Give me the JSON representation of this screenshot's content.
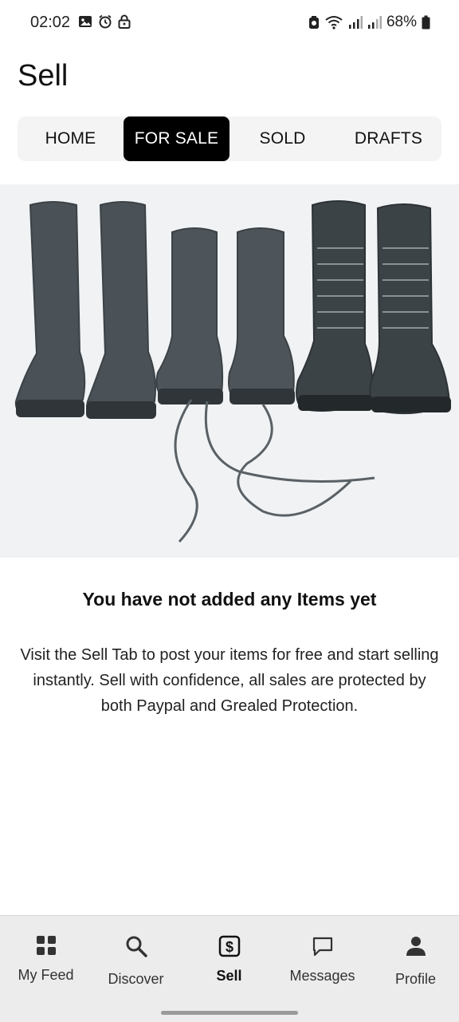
{
  "status_bar": {
    "time": "02:02",
    "battery": "68%",
    "icons": [
      "gallery-icon",
      "alarm-icon",
      "lock-icon",
      "data-saver-icon",
      "wifi-icon",
      "signal-icon",
      "signal-icon",
      "battery-icon"
    ]
  },
  "header": {
    "title": "Sell"
  },
  "tabs": [
    {
      "label": "HOME",
      "active": false
    },
    {
      "label": "FOR SALE",
      "active": true
    },
    {
      "label": "SOLD",
      "active": false
    },
    {
      "label": "DRAFTS",
      "active": false
    }
  ],
  "hero": {
    "image": "boots-photo"
  },
  "empty_state": {
    "heading": "You have not added any Items yet",
    "body": "Visit the Sell Tab to post your items for free and start selling instantly. Sell with confidence, all sales are protected by both Paypal and Grealed Protection."
  },
  "bottom_nav": [
    {
      "label": "My Feed",
      "icon": "grid-icon",
      "active": false
    },
    {
      "label": "Discover",
      "icon": "search-icon",
      "active": false
    },
    {
      "label": "Sell",
      "icon": "dollar-tag-icon",
      "active": true
    },
    {
      "label": "Messages",
      "icon": "chat-bubble-icon",
      "active": false
    },
    {
      "label": "Profile",
      "icon": "person-icon",
      "active": false
    }
  ],
  "colors": {
    "accent": "#000000",
    "nav_background": "#ececec",
    "tab_background": "#f4f4f4"
  }
}
